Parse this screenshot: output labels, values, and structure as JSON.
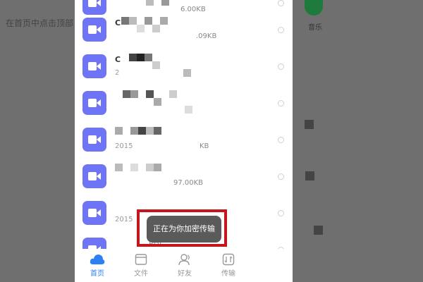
{
  "background": {
    "caption": "在首页中点击顶部",
    "music_label": "音乐"
  },
  "files": [
    {
      "name": "",
      "meta": "",
      "size": "6.00KB"
    },
    {
      "name": "C",
      "meta": "",
      "size": ".09KB"
    },
    {
      "name": "C",
      "meta": "2",
      "size": ""
    },
    {
      "name": "",
      "meta": "",
      "size": ""
    },
    {
      "name": "",
      "meta": "2015",
      "size": "KB"
    },
    {
      "name": "",
      "meta": "",
      "size": "97.00KB"
    },
    {
      "name": "",
      "meta": "2015",
      "size": ""
    },
    {
      "name": "",
      "meta": "",
      "size": "DAT"
    }
  ],
  "toast": {
    "text": "正在为你加密传输"
  },
  "tabs": [
    {
      "label": "首页",
      "icon": "cloud-icon"
    },
    {
      "label": "文件",
      "icon": "folder-icon"
    },
    {
      "label": "好友",
      "icon": "friends-icon"
    },
    {
      "label": "传输",
      "icon": "transfer-icon"
    }
  ],
  "colors": {
    "accent": "#2e7ff0",
    "file_icon": "#6f74f6",
    "highlight_frame": "#c4161c",
    "overlay": "#6f6f6f"
  }
}
